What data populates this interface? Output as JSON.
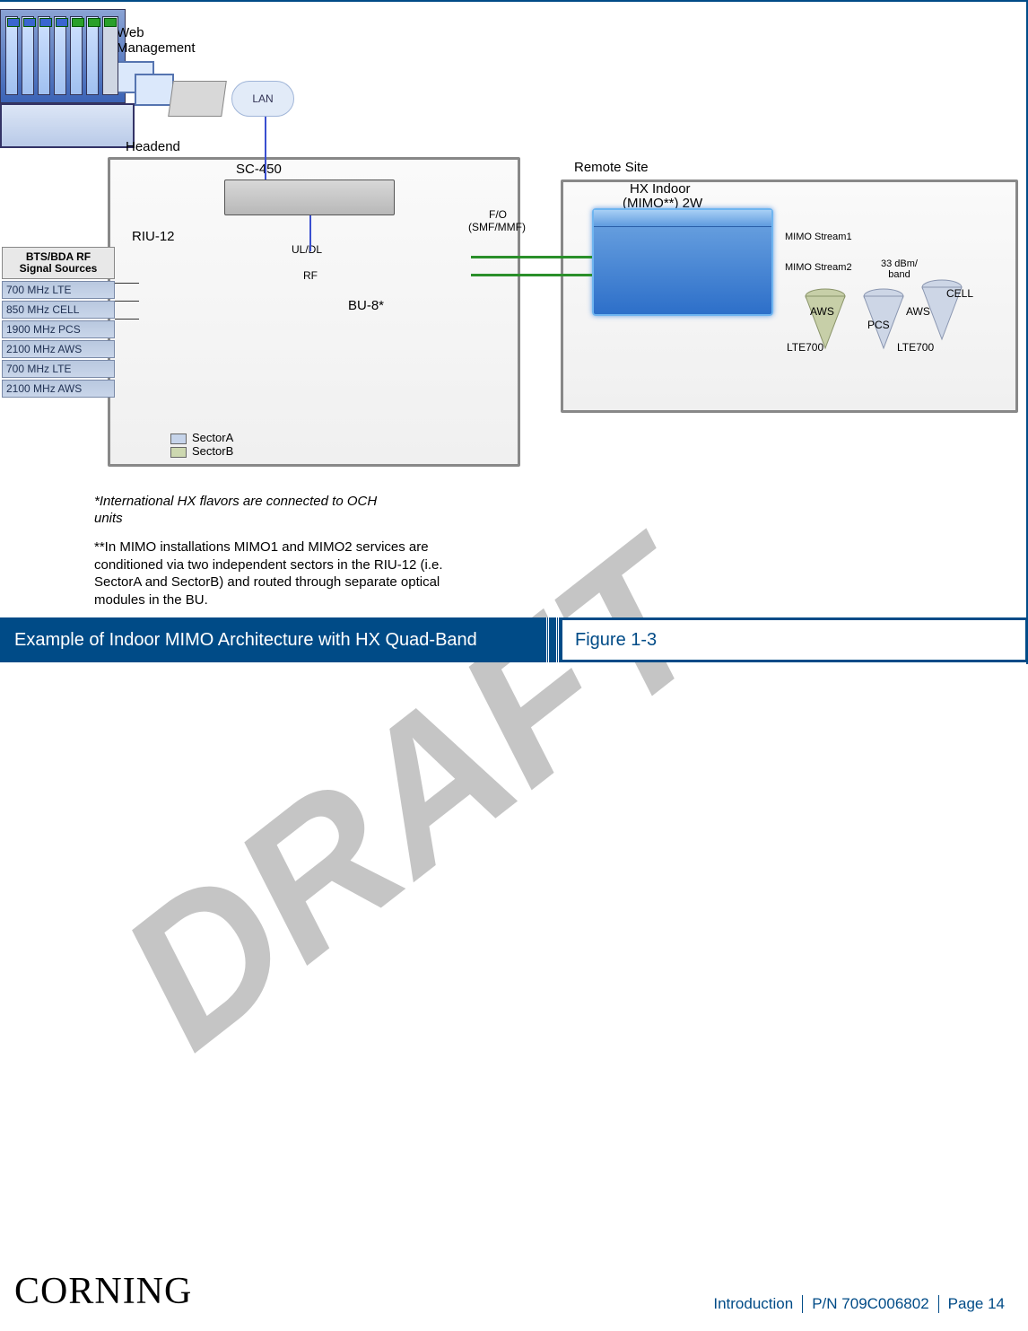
{
  "diagram": {
    "web_mgmt_label": "Web\nManagement",
    "lan_label": "LAN",
    "headend_label": "Headend",
    "remote_label": "Remote Site",
    "sc450_label": "SC-450",
    "riu12_label": "RIU-12",
    "bu8_label": "BU-8*",
    "uldl_label": "UL/DL",
    "rf_label": "RF",
    "fo_label_1": "F/O",
    "fo_label_2": "(SMF/MMF)",
    "hx_label_1": "HX Indoor",
    "hx_label_2": "(MIMO**) 2W",
    "mimo1": "MIMO Stream1",
    "mimo2": "MIMO Stream2",
    "power": "33 dBm/\nband",
    "cone_aws": "AWS",
    "cone_lte": "LTE700",
    "cone_pcs": "PCS",
    "cone_cell": "CELL",
    "signal_header": "BTS/BDA RF\nSignal Sources",
    "signals": [
      "700 MHz LTE",
      "850 MHz CELL",
      "1900 MHz PCS",
      "2100 MHz AWS",
      "700 MHz LTE",
      "2100 MHz AWS"
    ],
    "legend_a": "SectorA",
    "legend_b": "SectorB",
    "footnote_italic": "*International HX flavors are connected to OCH units",
    "footnote_plain": "**In MIMO installations MIMO1 and MIMO2 services are conditioned via two independent sectors in the RIU-12 (i.e. SectorA and SectorB) and routed through separate optical modules in the BU."
  },
  "caption": {
    "title": "Example of Indoor MIMO Architecture with HX Quad-Band",
    "figure": "Figure 1-3"
  },
  "footer": {
    "logo": "CORNING",
    "section": "Introduction",
    "pn": "P/N 709C006802",
    "page": "Page 14"
  },
  "watermark": "DRAFT"
}
